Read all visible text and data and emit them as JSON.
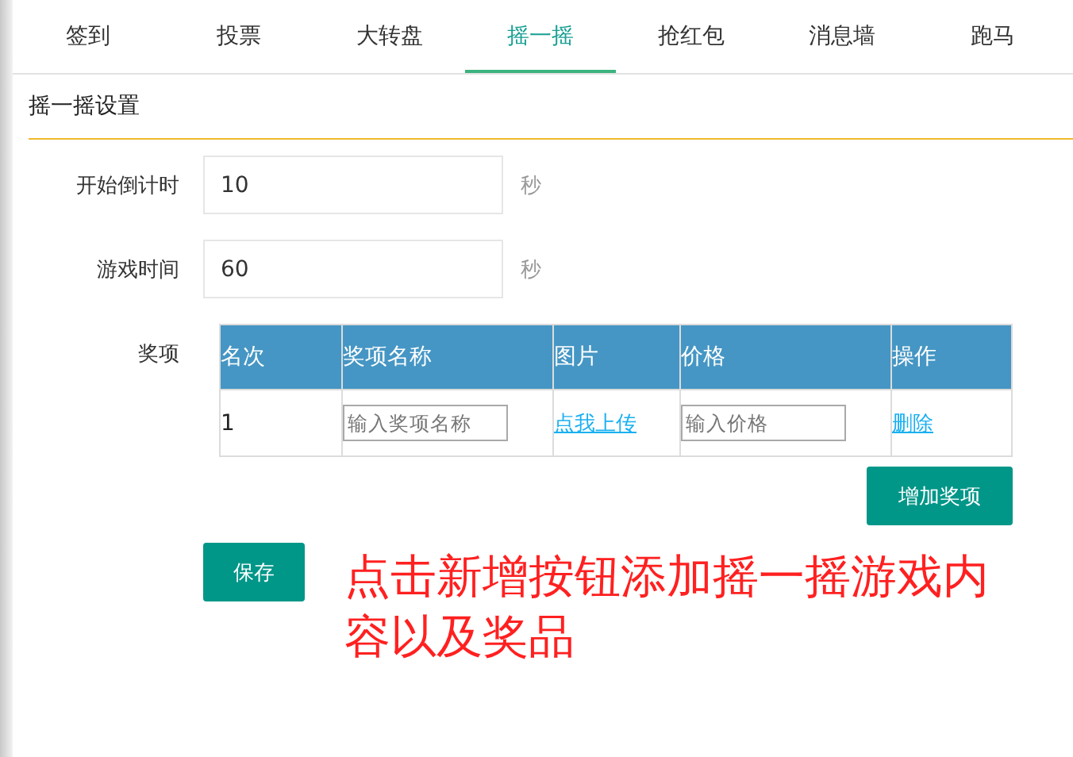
{
  "tabs": [
    {
      "label": "签到",
      "selected": false
    },
    {
      "label": "投票",
      "selected": false
    },
    {
      "label": "大转盘",
      "selected": false
    },
    {
      "label": "摇一摇",
      "selected": true
    },
    {
      "label": "抢红包",
      "selected": false
    },
    {
      "label": "消息墙",
      "selected": false
    },
    {
      "label": "跑马",
      "selected": false
    }
  ],
  "section_title": "摇一摇设置",
  "fields": [
    {
      "label": "开始倒计时",
      "value": "10",
      "unit": "秒"
    },
    {
      "label": "游戏时间",
      "value": "60",
      "unit": "秒"
    }
  ],
  "prizes": {
    "label": "奖项",
    "columns": [
      "名次",
      "奖项名称",
      "图片",
      "价格",
      "操作"
    ],
    "rows": [
      {
        "rank": "1",
        "name_placeholder": "输入奖项名称",
        "upload_link": "点我上传",
        "price_placeholder": "输入价格",
        "delete_link": "删除"
      }
    ],
    "add_button": "增加奖项"
  },
  "save_button": "保存",
  "annotation": "点击新增按钮添加摇一摇游戏内容以及奖品"
}
